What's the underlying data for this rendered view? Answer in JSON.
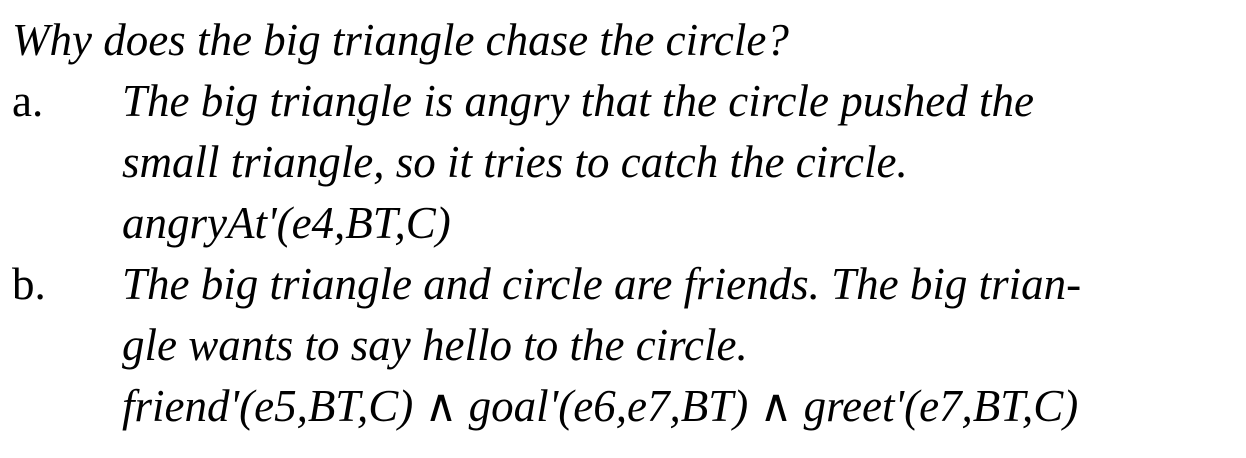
{
  "document": {
    "question": "Why does the big triangle chase the circle?",
    "items": [
      {
        "marker": "a.",
        "lines": [
          "The big triangle is angry that the circle pushed the",
          "small triangle, so it tries to catch the circle.",
          "angryAt'(e4,BT,C)"
        ]
      },
      {
        "marker": "b.",
        "lines": [
          "The big triangle and circle are friends. The big trian-",
          "gle wants to say hello to the circle.",
          "friend'(e5,BT,C) ∧ goal'(e6,e7,BT) ∧ greet'(e7,BT,C)"
        ]
      }
    ]
  }
}
